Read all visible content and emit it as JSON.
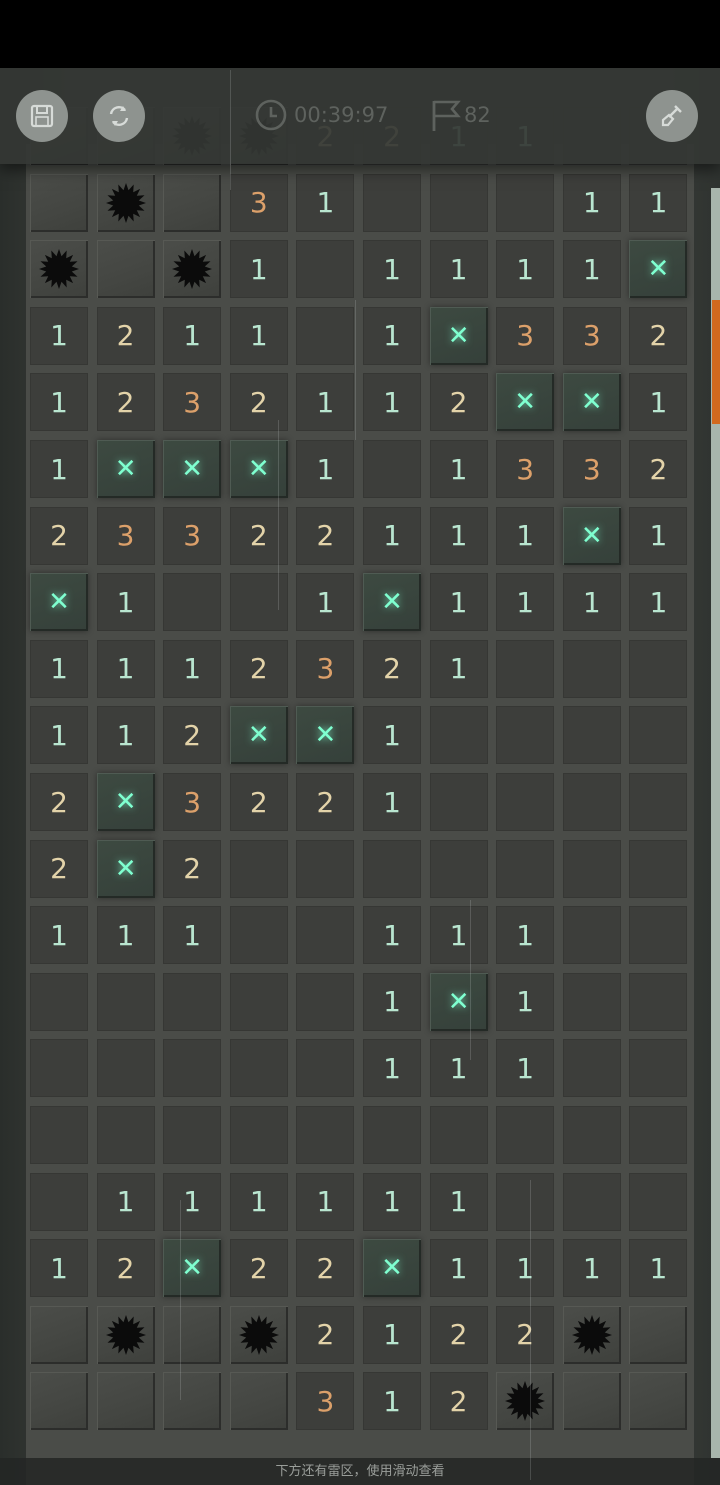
{
  "toolbar": {
    "save_icon": "save-icon",
    "restart_icon": "restart-icon",
    "timer_icon": "clock-icon",
    "timer": "00:39:97",
    "flag_icon": "flag-icon",
    "flags_remaining": "82",
    "shovel_icon": "shovel-icon"
  },
  "footer": {
    "hint": "下方还有雷区，使用滑动查看"
  },
  "colors": {
    "accent_scrollbar": "#d2691e",
    "flag": "#7fffd0",
    "num1": "#b9e6d0",
    "num2": "#e3d3a9",
    "num3": "#dca06a"
  },
  "legend": {
    "H": "unrevealed",
    "E": "revealed-empty",
    "F": "flagged",
    "M": "mine",
    "1-3": "adjacent mine count"
  },
  "board": {
    "columns": 10,
    "rows_visible": [
      [
        "H",
        "H",
        "M",
        "M",
        "2",
        "2",
        "1",
        "1",
        "E",
        "E"
      ],
      [
        "H",
        "M",
        "H",
        "3",
        "1",
        "E",
        "E",
        "E",
        "1",
        "1"
      ],
      [
        "M",
        "H",
        "M",
        "1",
        "E",
        "1",
        "1",
        "1",
        "1",
        "F"
      ],
      [
        "1",
        "2",
        "1",
        "1",
        "E",
        "1",
        "F",
        "3",
        "3",
        "2"
      ],
      [
        "1",
        "2",
        "3",
        "2",
        "1",
        "1",
        "2",
        "F",
        "F",
        "1"
      ],
      [
        "1",
        "F",
        "F",
        "F",
        "1",
        "E",
        "1",
        "3",
        "3",
        "2"
      ],
      [
        "2",
        "3",
        "3",
        "2",
        "2",
        "1",
        "1",
        "1",
        "F",
        "1"
      ],
      [
        "F",
        "1",
        "E",
        "E",
        "1",
        "F",
        "1",
        "1",
        "1",
        "1"
      ],
      [
        "1",
        "1",
        "1",
        "2",
        "3",
        "2",
        "1",
        "E",
        "E",
        "E"
      ],
      [
        "1",
        "1",
        "2",
        "F",
        "F",
        "1",
        "E",
        "E",
        "E",
        "E"
      ],
      [
        "2",
        "F",
        "3",
        "2",
        "2",
        "1",
        "E",
        "E",
        "E",
        "E"
      ],
      [
        "2",
        "F",
        "2",
        "E",
        "E",
        "E",
        "E",
        "E",
        "E",
        "E"
      ],
      [
        "1",
        "1",
        "1",
        "E",
        "E",
        "1",
        "1",
        "1",
        "E",
        "E"
      ],
      [
        "E",
        "E",
        "E",
        "E",
        "E",
        "1",
        "F",
        "1",
        "E",
        "E"
      ],
      [
        "E",
        "E",
        "E",
        "E",
        "E",
        "1",
        "1",
        "1",
        "E",
        "E"
      ],
      [
        "E",
        "E",
        "E",
        "E",
        "E",
        "E",
        "E",
        "E",
        "E",
        "E"
      ],
      [
        "E",
        "1",
        "1",
        "1",
        "1",
        "1",
        "1",
        "E",
        "E",
        "E"
      ],
      [
        "1",
        "2",
        "F",
        "2",
        "2",
        "F",
        "1",
        "1",
        "1",
        "1"
      ],
      [
        "H",
        "M",
        "H",
        "M",
        "2",
        "1",
        "2",
        "2",
        "M",
        "H"
      ],
      [
        "H",
        "H",
        "H",
        "H",
        "3",
        "1",
        "2",
        "M",
        "H",
        "H"
      ]
    ]
  }
}
